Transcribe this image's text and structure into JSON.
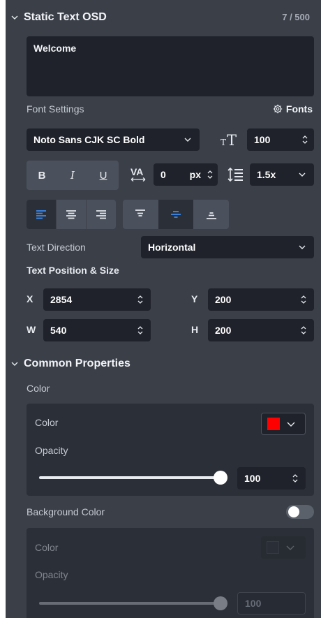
{
  "osd": {
    "title": "Static Text OSD",
    "char_count": "7 / 500",
    "text_value": "Welcome"
  },
  "font_settings": {
    "label": "Font Settings",
    "fonts_link": "Fonts",
    "font_family": "Noto Sans CJK SC Bold",
    "font_size": "100",
    "letter_spacing": "0",
    "letter_spacing_unit": "px",
    "line_height": "1.5x",
    "bold_label": "B",
    "italic_label": "I",
    "underline_label": "U"
  },
  "text_direction": {
    "label": "Text Direction",
    "value": "Horizontal"
  },
  "position": {
    "label": "Text Position & Size",
    "x_label": "X",
    "x_value": "2854",
    "y_label": "Y",
    "y_value": "200",
    "w_label": "W",
    "w_value": "540",
    "h_label": "H",
    "h_value": "200"
  },
  "common": {
    "title": "Common Properties",
    "color_section": "Color",
    "color_label": "Color",
    "color_swatch": "#ff0000",
    "opacity_label": "Opacity",
    "opacity_value": "100",
    "opacity_fraction": 1.0,
    "bg_label": "Background Color",
    "bg_enabled": false,
    "bg_color_label": "Color",
    "bg_color_swatch": "#2a2e36",
    "bg_opacity_label": "Opacity",
    "bg_opacity_value": "100",
    "bg_opacity_fraction": 1.0
  },
  "colors": {
    "panel_bg": "#3a3f48",
    "field_bg": "#1f222a",
    "accent": "#3d8bf0"
  },
  "icons": [
    "chevron-down-icon",
    "gear-icon",
    "font-size-icon",
    "letter-spacing-icon",
    "line-height-icon",
    "align-left-icon",
    "align-center-icon",
    "align-right-icon",
    "valign-top-icon",
    "valign-middle-icon",
    "valign-bottom-icon",
    "spinner-icon"
  ]
}
